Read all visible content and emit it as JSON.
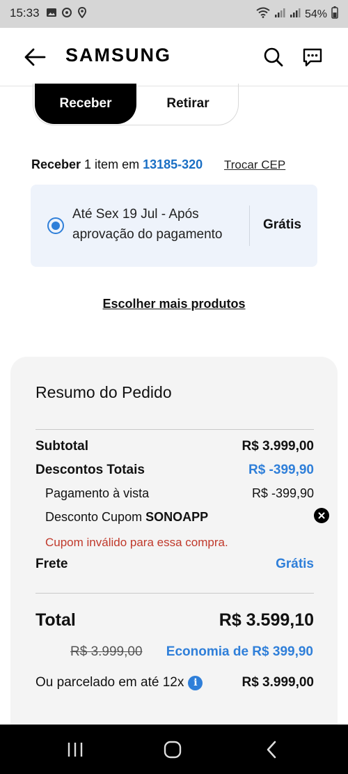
{
  "status_bar": {
    "time": "15:33",
    "battery": "54%"
  },
  "header": {
    "brand": "SAMSUNG"
  },
  "delivery_toggle": {
    "active": "Receber",
    "inactive": "Retirar"
  },
  "receive_line": {
    "prefix": "Receber",
    "middle": " 1 item em ",
    "cep": "13185-320",
    "change_cep": "Trocar CEP"
  },
  "delivery_option": {
    "text": "Até Sex 19 Jul - Após aprovação do pagamento",
    "price": "Grátis"
  },
  "more_products": "Escolher mais produtos",
  "summary": {
    "title": "Resumo do Pedido",
    "subtotal_label": "Subtotal",
    "subtotal_value": "R$ 3.999,00",
    "discounts_label": "Descontos Totais",
    "discounts_value": "R$ -399,90",
    "cash_label": "Pagamento à vista",
    "cash_value": "R$ -399,90",
    "coupon_label": "Desconto Cupom ",
    "coupon_code": "SONOAPP",
    "coupon_error": "Cupom inválido para essa compra.",
    "shipping_label": "Frete",
    "shipping_value": "Grátis",
    "total_label": "Total",
    "total_value": "R$ 3.599,10",
    "old_price": "R$ 3.999,00",
    "savings": "Economia de R$ 399,90",
    "installment_label": "Ou parcelado em até 12x",
    "installment_value": "R$ 3.999,00"
  },
  "colors": {
    "accent": "#2f7fd9",
    "error": "#c0392b",
    "card_bg": "#eef3fb",
    "summary_bg": "#f4f4f4"
  }
}
